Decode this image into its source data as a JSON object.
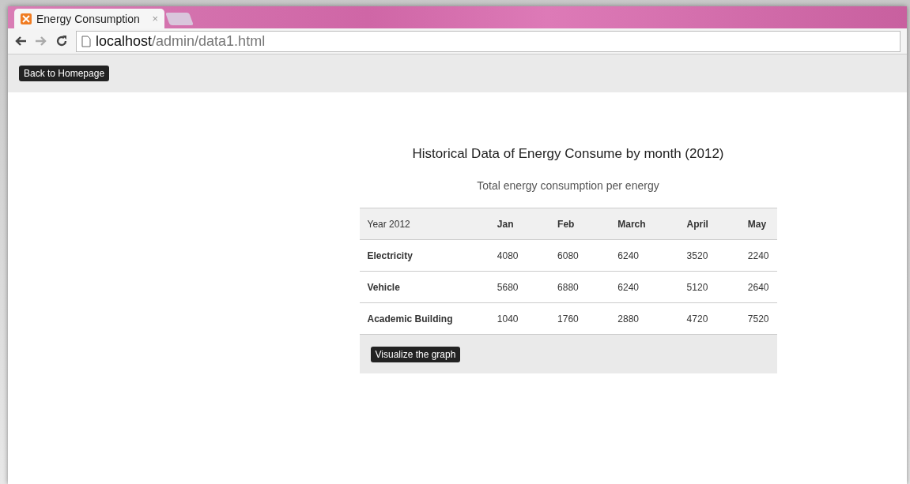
{
  "browser": {
    "tab": {
      "title": "Energy Consumption",
      "close": "×",
      "selected": true
    },
    "address": {
      "host": "localhost",
      "path": "/admin/data1.html"
    }
  },
  "header": {
    "back_button": "Back to Homepage"
  },
  "page": {
    "title": "Historical Data of Energy Consume by month (2012)",
    "subtitle": "Total energy consumption per energy"
  },
  "table": {
    "columns": [
      "Year 2012",
      "Jan",
      "Feb",
      "March",
      "April",
      "May"
    ],
    "rows": [
      [
        "Electricity",
        "4080",
        "6080",
        "6240",
        "3520",
        "2240"
      ],
      [
        "Vehicle",
        "5680",
        "6880",
        "6240",
        "5120",
        "2640"
      ],
      [
        "Academic Building",
        "1040",
        "1760",
        "2880",
        "4720",
        "7520"
      ]
    ]
  },
  "footer_button": "Visualize the graph"
}
